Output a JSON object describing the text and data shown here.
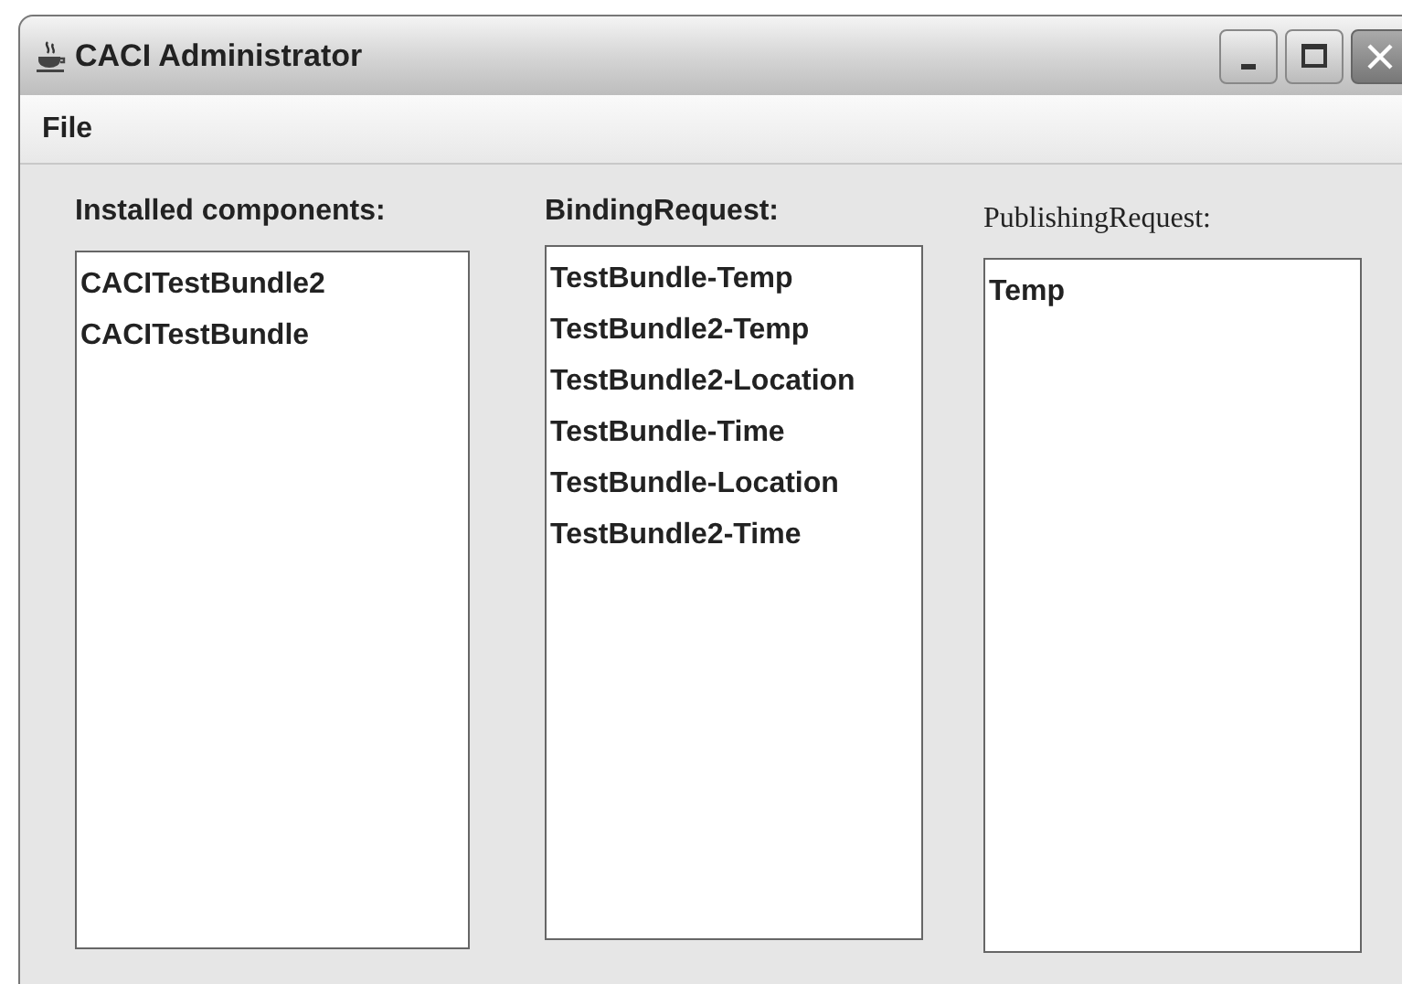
{
  "window": {
    "title": "CACI Administrator"
  },
  "menu": [
    "File"
  ],
  "lists": [
    {
      "label": "Installed components:",
      "items": [
        "CACITestBundle2",
        "CACITestBundle"
      ]
    },
    {
      "label": "BindingRequest:",
      "items": [
        "TestBundle-Temp",
        "TestBundle2-Temp",
        "TestBundle2-Location",
        "TestBundle-Time",
        "TestBundle-Location",
        "TestBundle2-Time"
      ]
    },
    {
      "label": "PublishingRequest:",
      "items": [
        "Temp"
      ]
    }
  ]
}
